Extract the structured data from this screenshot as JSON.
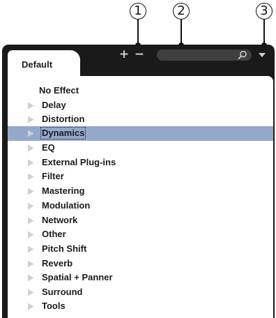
{
  "callouts": [
    "1",
    "2",
    "3"
  ],
  "panel": {
    "tab_label": "Default",
    "add_label": "+",
    "remove_label": "−",
    "search": {
      "value": "",
      "placeholder": ""
    },
    "icons": {
      "search": "search-icon",
      "dropdown": "triangle-down-icon",
      "expand": "triangle-right-icon"
    }
  },
  "tree": {
    "selected": "Dynamics",
    "items": [
      {
        "label": "No Effect",
        "expandable": false
      },
      {
        "label": "Delay",
        "expandable": true
      },
      {
        "label": "Distortion",
        "expandable": true
      },
      {
        "label": "Dynamics",
        "expandable": true
      },
      {
        "label": "EQ",
        "expandable": true
      },
      {
        "label": "External Plug-ins",
        "expandable": true
      },
      {
        "label": "Filter",
        "expandable": true
      },
      {
        "label": "Mastering",
        "expandable": true
      },
      {
        "label": "Modulation",
        "expandable": true
      },
      {
        "label": "Network",
        "expandable": true
      },
      {
        "label": "Other",
        "expandable": true
      },
      {
        "label": "Pitch Shift",
        "expandable": true
      },
      {
        "label": "Reverb",
        "expandable": true
      },
      {
        "label": "Spatial + Panner",
        "expandable": true
      },
      {
        "label": "Surround",
        "expandable": true
      },
      {
        "label": "Tools",
        "expandable": true
      }
    ]
  },
  "colors": {
    "frame": "#1a1a1a",
    "selection": "#93a9cb",
    "search_bg": "#3f3f3f",
    "arrow": "#d0d0d0",
    "text": "#1b1b1b"
  }
}
